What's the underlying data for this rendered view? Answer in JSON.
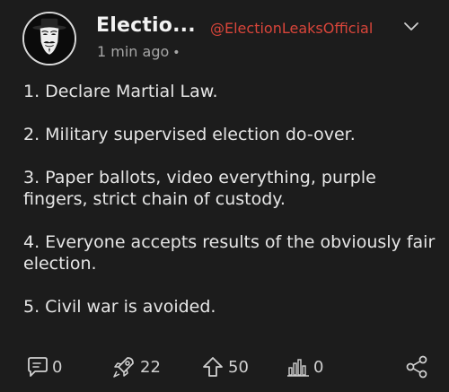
{
  "post": {
    "display_name": "Electio...",
    "handle": "@ElectionLeaksOfficial",
    "timestamp": "1 min ago",
    "timestamp_dot": "•",
    "lines": [
      "1. Declare Martial Law.",
      "2. Military supervised election do-over.",
      "3. Paper ballots, video everything, purple fingers, strict chain of custody.",
      "4. Everyone accepts results of the obviously fair election.",
      "5. Civil war is avoided."
    ]
  },
  "actions": {
    "comments": "0",
    "tips": "22",
    "upvotes": "50",
    "views": "0"
  },
  "icons": {
    "avatar": "guy-fawkes-mask-icon",
    "chevron": "chevron-down-icon",
    "comment": "comment-bubble-icon",
    "tip": "rocket-icon",
    "upvote": "upvote-arrow-icon",
    "views": "bar-chart-icon",
    "share": "share-icon"
  },
  "colors": {
    "background": "#1c1c1c",
    "handle": "#d9453a",
    "text": "#e6e6e6",
    "muted": "#a6a6a6"
  }
}
